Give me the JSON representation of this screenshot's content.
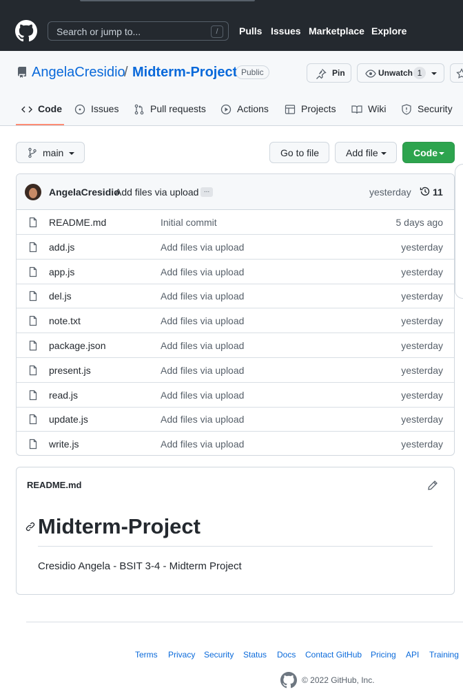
{
  "header": {
    "search_placeholder": "Search or jump to...",
    "search_shortcut": "/",
    "nav": [
      "Pulls",
      "Issues",
      "Marketplace",
      "Explore"
    ]
  },
  "repo": {
    "owner": "AngelaCresidio",
    "separator": "/",
    "name": "Midterm-Project",
    "visibility": "Public",
    "pin_label": "Pin",
    "watch_label": "Unwatch",
    "watch_count": "1"
  },
  "tabs": [
    {
      "label": "Code",
      "icon": "code-icon",
      "selected": true
    },
    {
      "label": "Issues",
      "icon": "issue-opened-icon"
    },
    {
      "label": "Pull requests",
      "icon": "git-pull-request-icon"
    },
    {
      "label": "Actions",
      "icon": "play-icon"
    },
    {
      "label": "Projects",
      "icon": "table-icon"
    },
    {
      "label": "Wiki",
      "icon": "book-icon"
    },
    {
      "label": "Security",
      "icon": "shield-icon"
    }
  ],
  "toolbar": {
    "branch": "main",
    "go_to_file": "Go to file",
    "add_file": "Add file",
    "code": "Code"
  },
  "latest_commit": {
    "author": "AngelaCresidio",
    "message": "Add files via upload",
    "ellipsis": "...",
    "time": "yesterday",
    "commit_count": "11"
  },
  "files": [
    {
      "name": "README.md",
      "message": "Initial commit",
      "date": "5 days ago"
    },
    {
      "name": "add.js",
      "message": "Add files via upload",
      "date": "yesterday"
    },
    {
      "name": "app.js",
      "message": "Add files via upload",
      "date": "yesterday"
    },
    {
      "name": "del.js",
      "message": "Add files via upload",
      "date": "yesterday"
    },
    {
      "name": "note.txt",
      "message": "Add files via upload",
      "date": "yesterday"
    },
    {
      "name": "package.json",
      "message": "Add files via upload",
      "date": "yesterday"
    },
    {
      "name": "present.js",
      "message": "Add files via upload",
      "date": "yesterday"
    },
    {
      "name": "read.js",
      "message": "Add files via upload",
      "date": "yesterday"
    },
    {
      "name": "update.js",
      "message": "Add files via upload",
      "date": "yesterday"
    },
    {
      "name": "write.js",
      "message": "Add files via upload",
      "date": "yesterday"
    }
  ],
  "readme": {
    "filename": "README.md",
    "heading": "Midterm-Project",
    "body": "Cresidio Angela - BSIT 3-4 - Midterm Project"
  },
  "footer": {
    "links": [
      "Terms",
      "Privacy",
      "Security",
      "Status",
      "Docs",
      "Contact GitHub",
      "Pricing",
      "API",
      "Training"
    ],
    "copyright": "© 2022 GitHub, Inc."
  },
  "colors": {
    "header_bg": "#24292f",
    "link": "#0969da",
    "primary_button": "#2da44e",
    "tab_underline": "#fd8c73"
  }
}
